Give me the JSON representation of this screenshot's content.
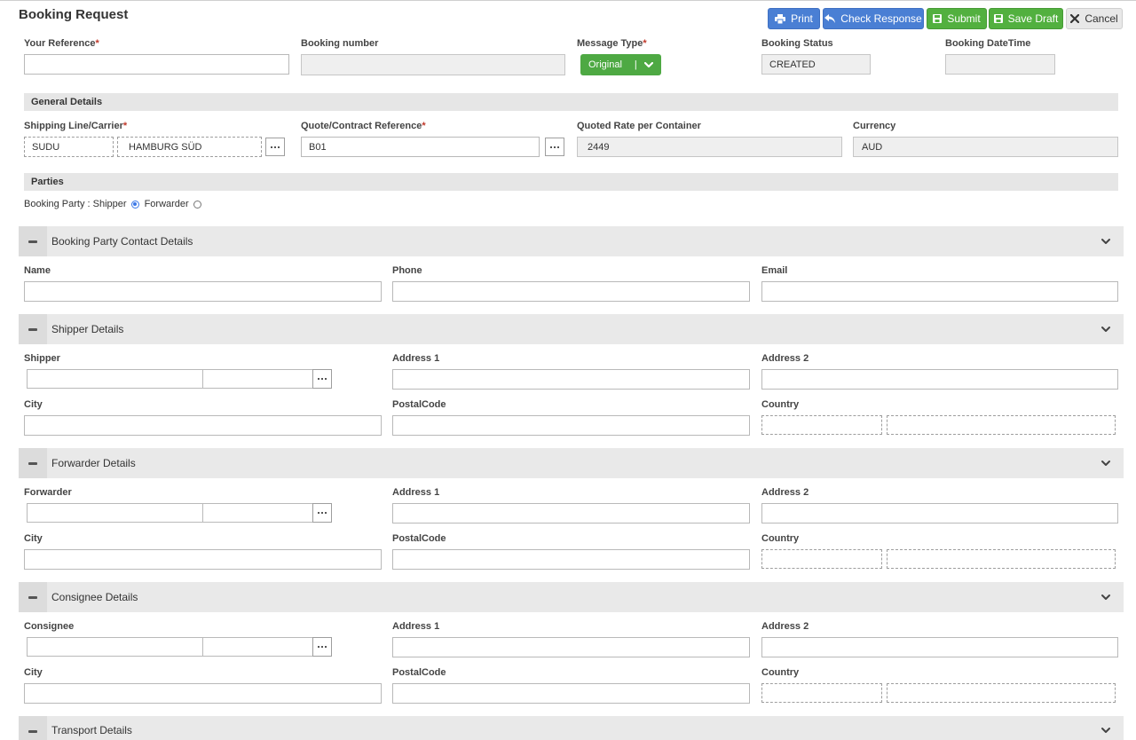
{
  "title": "Booking Request",
  "toolbar": {
    "print": "Print",
    "check_response": "Check Response",
    "submit": "Submit",
    "save_draft": "Save Draft",
    "cancel": "Cancel"
  },
  "header": {
    "your_reference_label": "Your Reference",
    "required_mark": "*",
    "your_reference_value": "",
    "booking_number_label": "Booking number",
    "booking_number_value": "",
    "message_type_label": "Message Type",
    "message_type_value": "Original",
    "message_type_sep": "|",
    "booking_status_label": "Booking Status",
    "booking_status_value": "CREATED",
    "booking_datetime_label": "Booking DateTime",
    "booking_datetime_value": ""
  },
  "general": {
    "heading": "General Details",
    "carrier_label": "Shipping Line/Carrier",
    "carrier_code": "SUDU",
    "carrier_name": "HAMBURG SÜD",
    "quote_label": "Quote/Contract Reference",
    "quote_value": "B01",
    "rate_label": "Quoted Rate per Container",
    "rate_value": "2449",
    "currency_label": "Currency",
    "currency_value": "AUD"
  },
  "parties": {
    "heading": "Parties",
    "booking_party_label": "Booking Party : Shipper",
    "forwarder_option": "Forwarder",
    "selected": "Shipper"
  },
  "contact": {
    "title": "Booking Party Contact Details",
    "name_label": "Name",
    "phone_label": "Phone",
    "email_label": "Email"
  },
  "shipper": {
    "title": "Shipper Details",
    "party_label": "Shipper",
    "address1_label": "Address 1",
    "address2_label": "Address 2",
    "city_label": "City",
    "postal_label": "PostalCode",
    "country_label": "Country"
  },
  "forwarder": {
    "title": "Forwarder Details",
    "party_label": "Forwarder",
    "address1_label": "Address 1",
    "address2_label": "Address 2",
    "city_label": "City",
    "postal_label": "PostalCode",
    "country_label": "Country"
  },
  "consignee": {
    "title": "Consignee Details",
    "party_label": "Consignee",
    "address1_label": "Address 1",
    "address2_label": "Address 2",
    "city_label": "City",
    "postal_label": "PostalCode",
    "country_label": "Country"
  },
  "transport": {
    "title": "Transport Details"
  },
  "colors": {
    "primary_blue": "#4a7fd4",
    "success_green": "#52b03f",
    "required_red": "#c0392b",
    "panel_gray": "#e9e9e9"
  },
  "icons": [
    "print-icon",
    "reply-icon",
    "save-icon",
    "close-icon",
    "chevron-down-icon",
    "collapse-icon",
    "ellipsis-icon"
  ]
}
